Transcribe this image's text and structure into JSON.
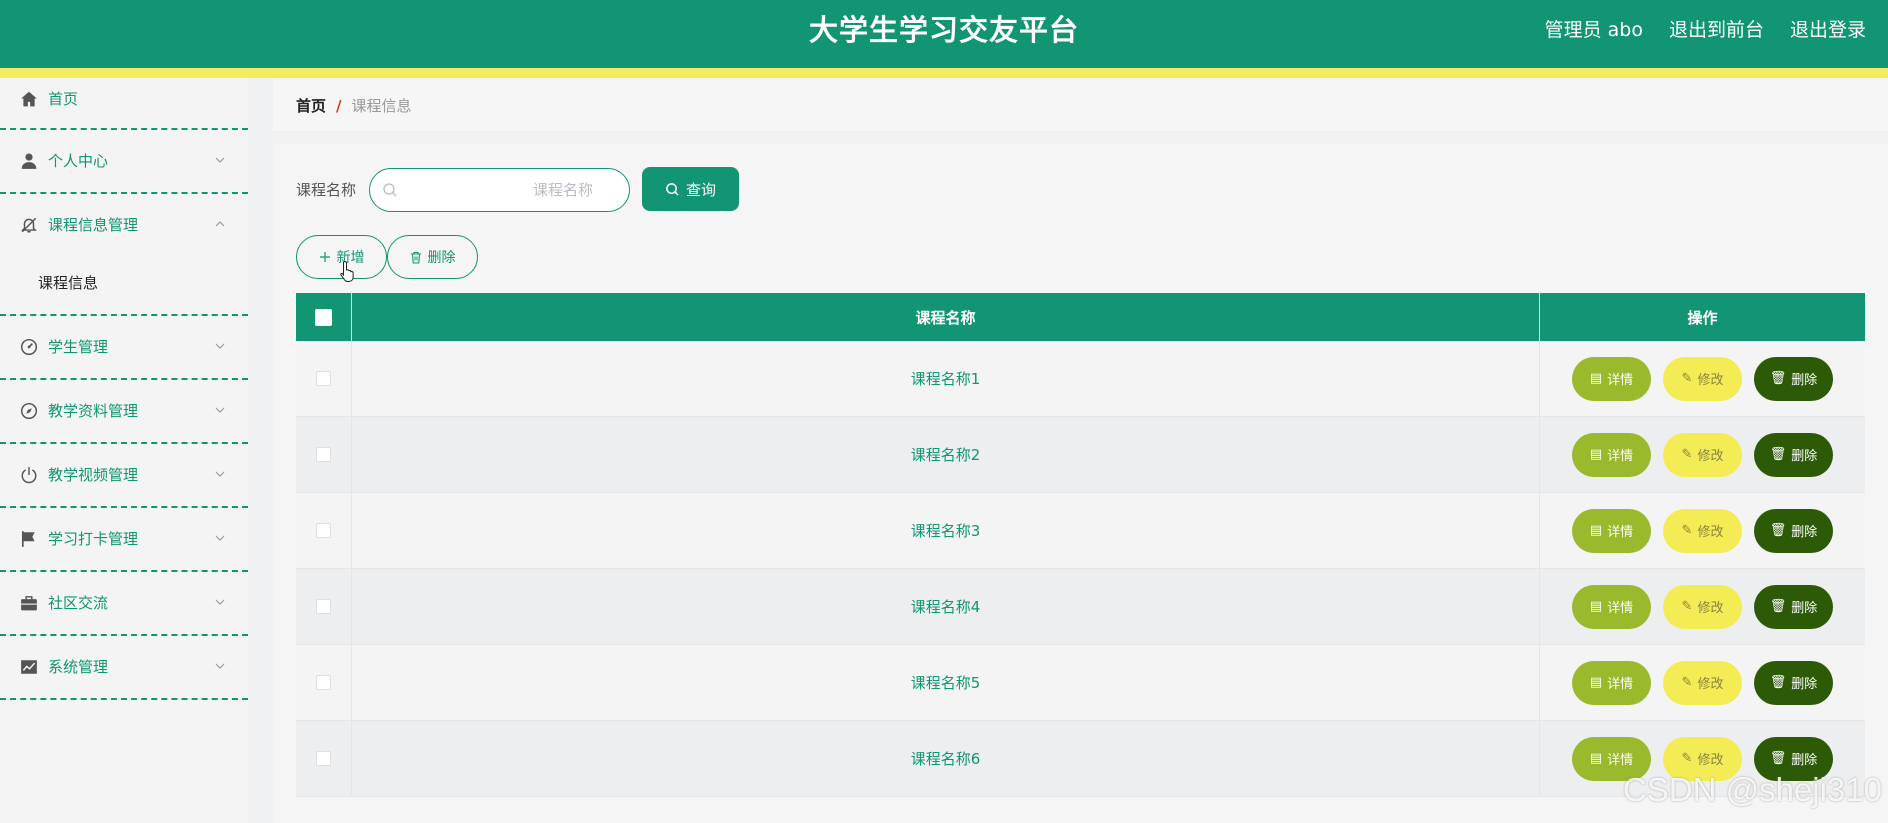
{
  "header": {
    "title": "大学生学习交友平台",
    "user_label": "管理员 abo",
    "front_link": "退出到前台",
    "logout": "退出登录"
  },
  "sidebar": {
    "items": [
      {
        "label": "首页",
        "icon": "home-icon"
      },
      {
        "label": "个人中心",
        "icon": "user-icon"
      },
      {
        "label": "课程信息管理",
        "icon": "bell-off-icon",
        "sub": "课程信息"
      },
      {
        "label": "学生管理",
        "icon": "odometer-icon"
      },
      {
        "label": "教学资料管理",
        "icon": "compass-icon"
      },
      {
        "label": "教学视频管理",
        "icon": "power-icon"
      },
      {
        "label": "学习打卡管理",
        "icon": "flag-icon"
      },
      {
        "label": "社区交流",
        "icon": "briefcase-icon"
      },
      {
        "label": "系统管理",
        "icon": "chart-icon"
      }
    ]
  },
  "breadcrumb": {
    "home": "首页",
    "sep": "/",
    "current": "课程信息"
  },
  "search": {
    "label": "课程名称",
    "placeholder": "课程名称",
    "button": "查询"
  },
  "actions": {
    "add": "新增",
    "delete": "删除"
  },
  "table": {
    "headers": {
      "name": "课程名称",
      "ops": "操作"
    },
    "rows": [
      {
        "name": "课程名称1"
      },
      {
        "name": "课程名称2"
      },
      {
        "name": "课程名称3"
      },
      {
        "name": "课程名称4"
      },
      {
        "name": "课程名称5"
      },
      {
        "name": "课程名称6"
      }
    ],
    "row_actions": {
      "detail": "详情",
      "edit": "修改",
      "delete": "删除"
    }
  },
  "watermark": "CSDN @sheji310",
  "colors": {
    "primary": "#119573",
    "accent": "#f2ec5e",
    "detail": "#9ab92c",
    "edit": "#f3ec55",
    "delete": "#2c5a06"
  }
}
